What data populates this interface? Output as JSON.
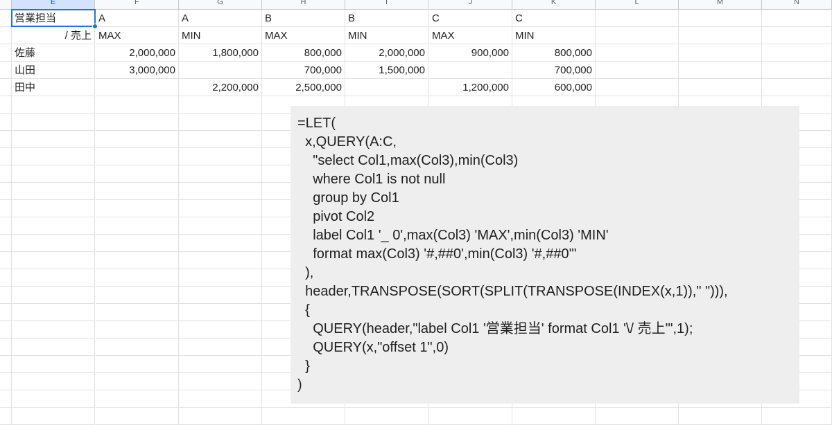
{
  "columns": [
    "E",
    "F",
    "G",
    "H",
    "I",
    "J",
    "K",
    "L",
    "M",
    "N"
  ],
  "selected_cell_value": "営業担当",
  "rows": [
    [
      "営業担当",
      "A",
      "A",
      "B",
      "B",
      "C",
      "C"
    ],
    [
      "/ 売上",
      "MAX",
      "MIN",
      "MAX",
      "MIN",
      "MAX",
      "MIN"
    ],
    [
      "佐藤",
      "2,000,000",
      "1,800,000",
      "800,000",
      "2,000,000",
      "900,000",
      "800,000"
    ],
    [
      "山田",
      "3,000,000",
      "",
      "700,000",
      "1,500,000",
      "",
      "700,000"
    ],
    [
      "田中",
      "",
      "2,200,000",
      "2,500,000",
      "",
      "1,200,000",
      "600,000"
    ]
  ],
  "formula_lines": [
    "=LET(",
    "  x,QUERY(A:C,",
    "    \"select Col1,max(Col3),min(Col3)",
    "    where Col1 is not null",
    "    group by Col1",
    "    pivot Col2",
    "    label Col1 '_ 0',max(Col3) 'MAX',min(Col3) 'MIN'",
    "    format max(Col3) '#,##0',min(Col3) '#,##0'\"",
    "  ),",
    "  header,TRANSPOSE(SORT(SPLIT(TRANSPOSE(INDEX(x,1)),\" \"))),",
    "  {",
    "    QUERY(header,\"label Col1 '営業担当' format Col1 '\\/ 売上'\",1);",
    "    QUERY(x,\"offset 1\",0)",
    "  }",
    ")"
  ]
}
